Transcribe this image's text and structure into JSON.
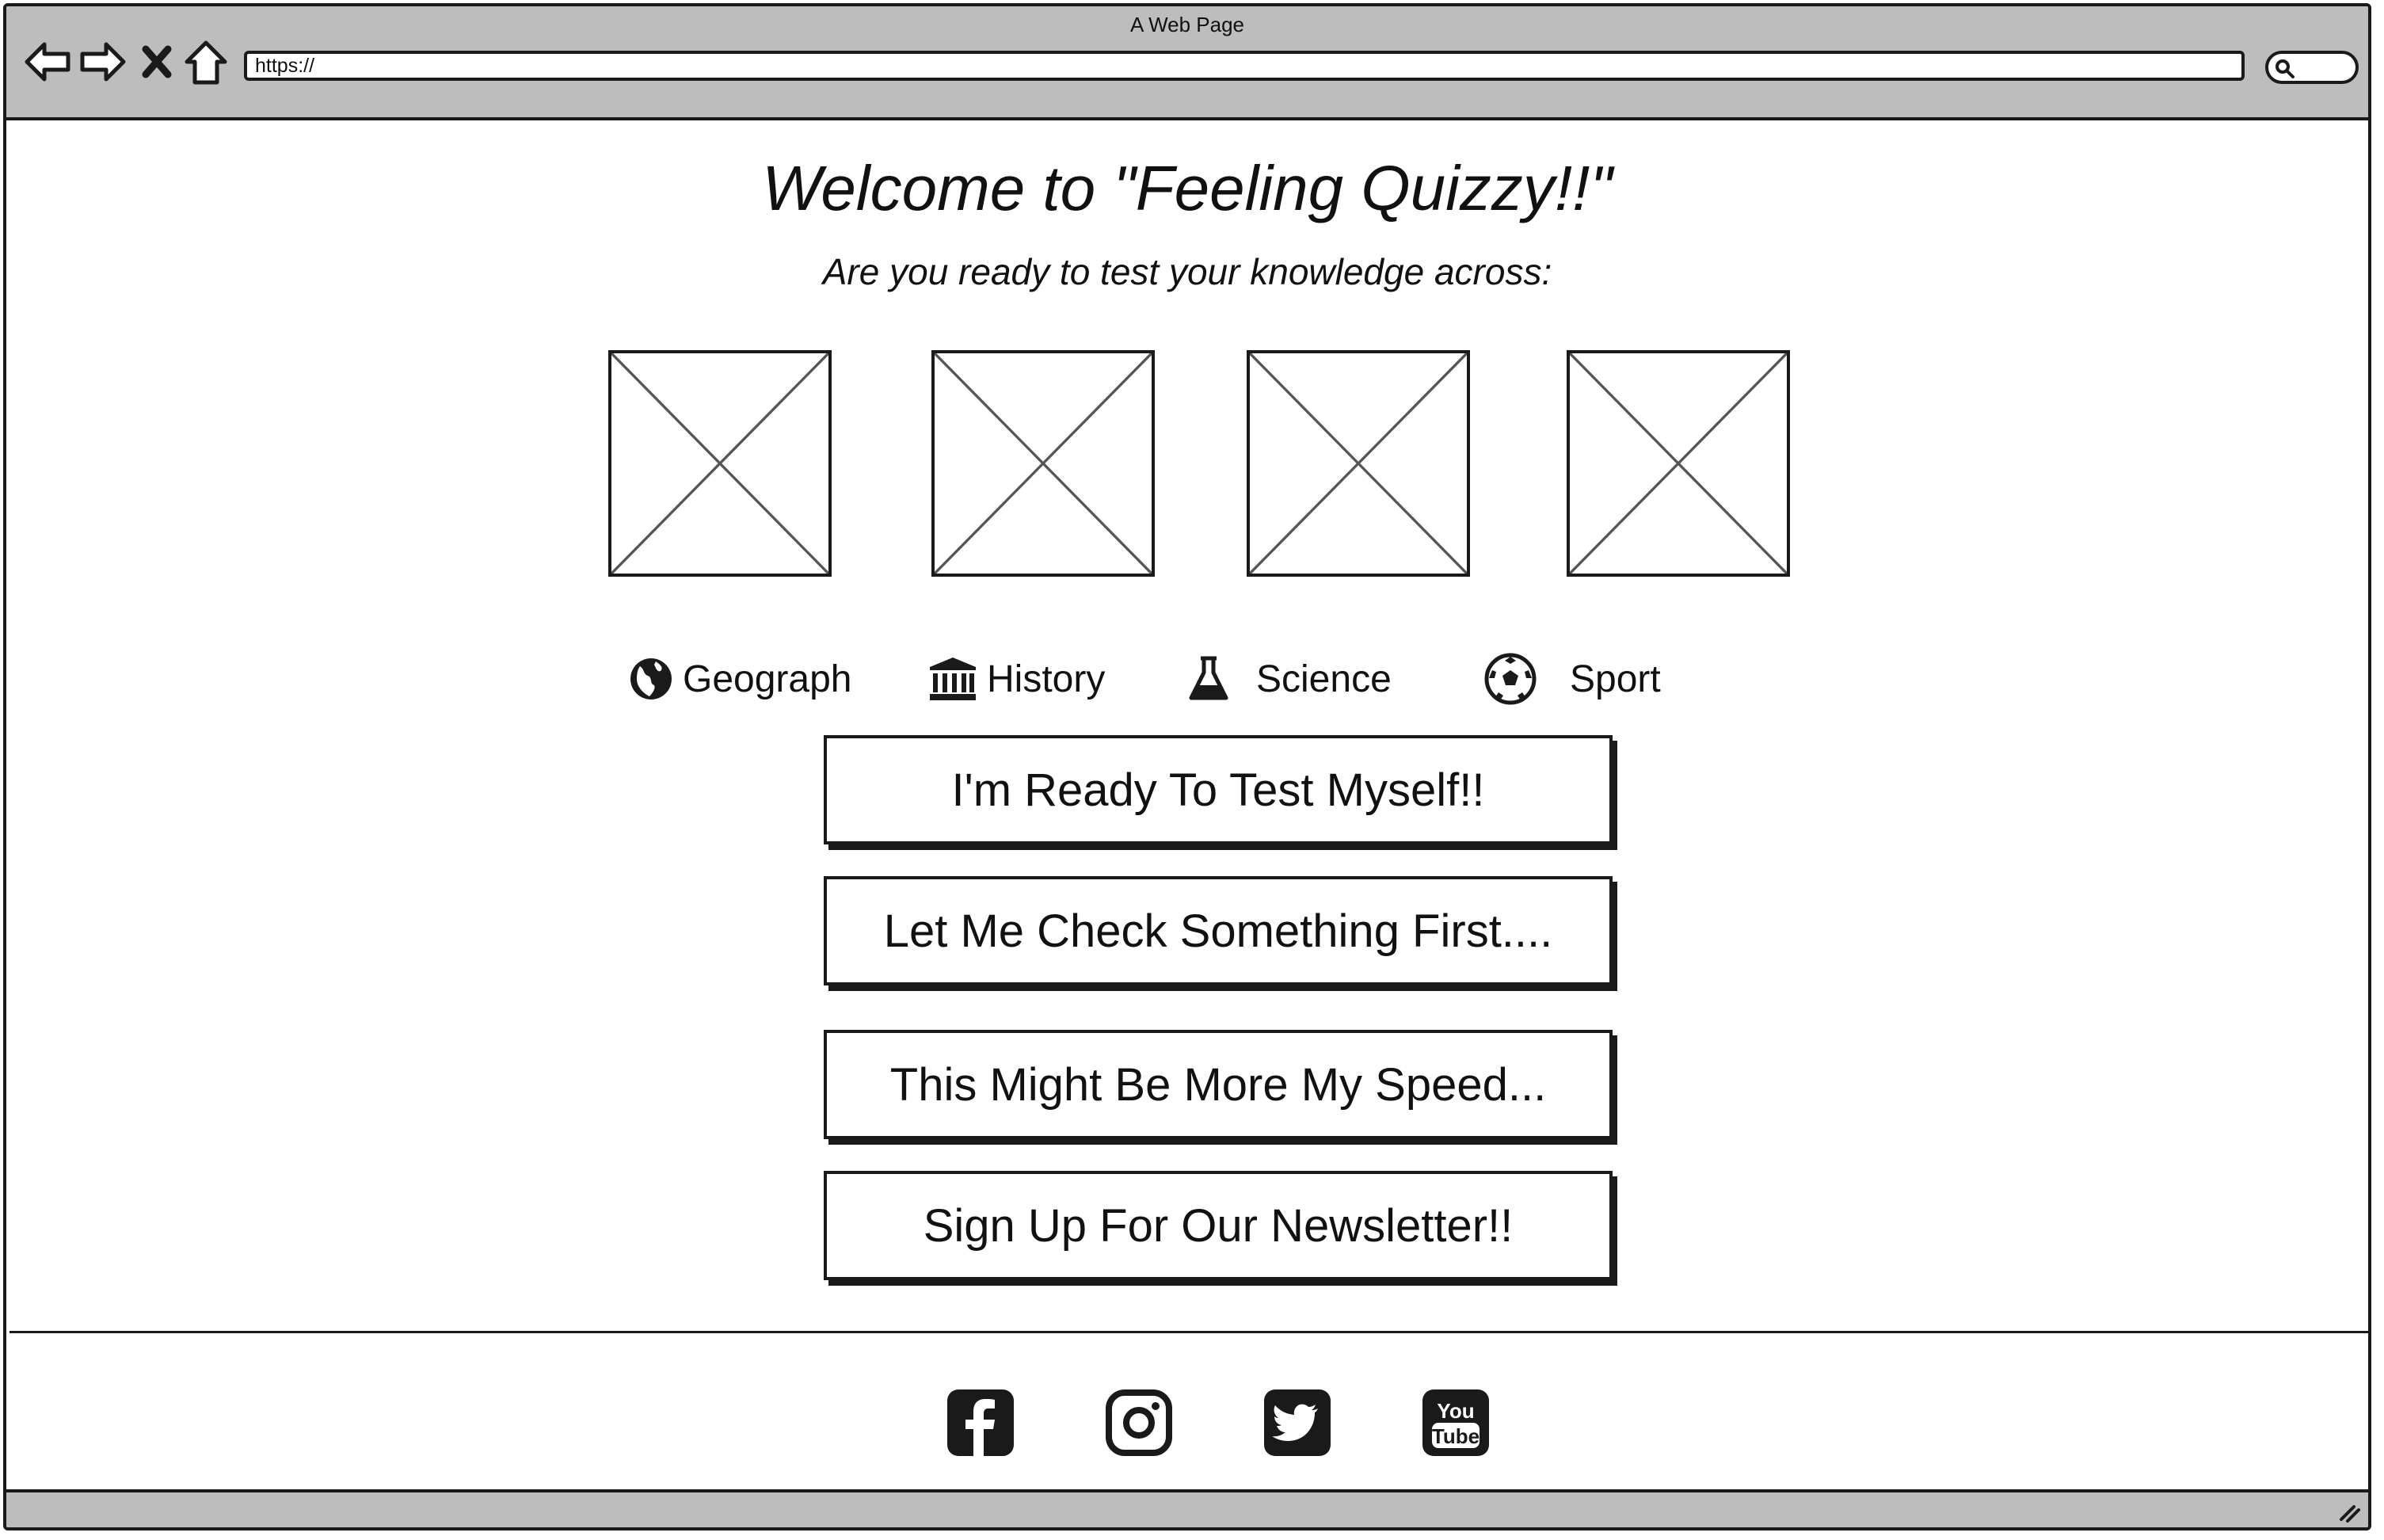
{
  "browser": {
    "window_title": "A Web Page",
    "url": "https://",
    "buttons": [
      "back-icon",
      "forward-icon",
      "stop-icon",
      "home-icon",
      "search-icon"
    ]
  },
  "page": {
    "heading": "Welcome to \"Feeling Quizzy!!\"",
    "subheading": "Are you ready to test your knowledge across:",
    "categories": [
      {
        "label": "Geograph",
        "icon": "globe-icon"
      },
      {
        "label": "History",
        "icon": "museum-icon"
      },
      {
        "label": "Science",
        "icon": "flask-icon"
      },
      {
        "label": "Sport",
        "icon": "soccer-ball-icon"
      }
    ],
    "buttons": [
      {
        "label": "I'm Ready To Test Myself!!"
      },
      {
        "label": "Let Me Check Something First...."
      },
      {
        "label": "This Might Be More My Speed..."
      },
      {
        "label": "Sign Up For Our Newsletter!!"
      }
    ]
  },
  "footer": {
    "social": [
      "facebook-icon",
      "instagram-icon",
      "twitter-icon",
      "youtube-icon"
    ],
    "youtube_text_top": "You",
    "youtube_text_bottom": "Tube"
  },
  "colors": {
    "chrome": "#bdbdbd",
    "ink": "#1a1a1a",
    "placeholder_line": "#555555"
  }
}
